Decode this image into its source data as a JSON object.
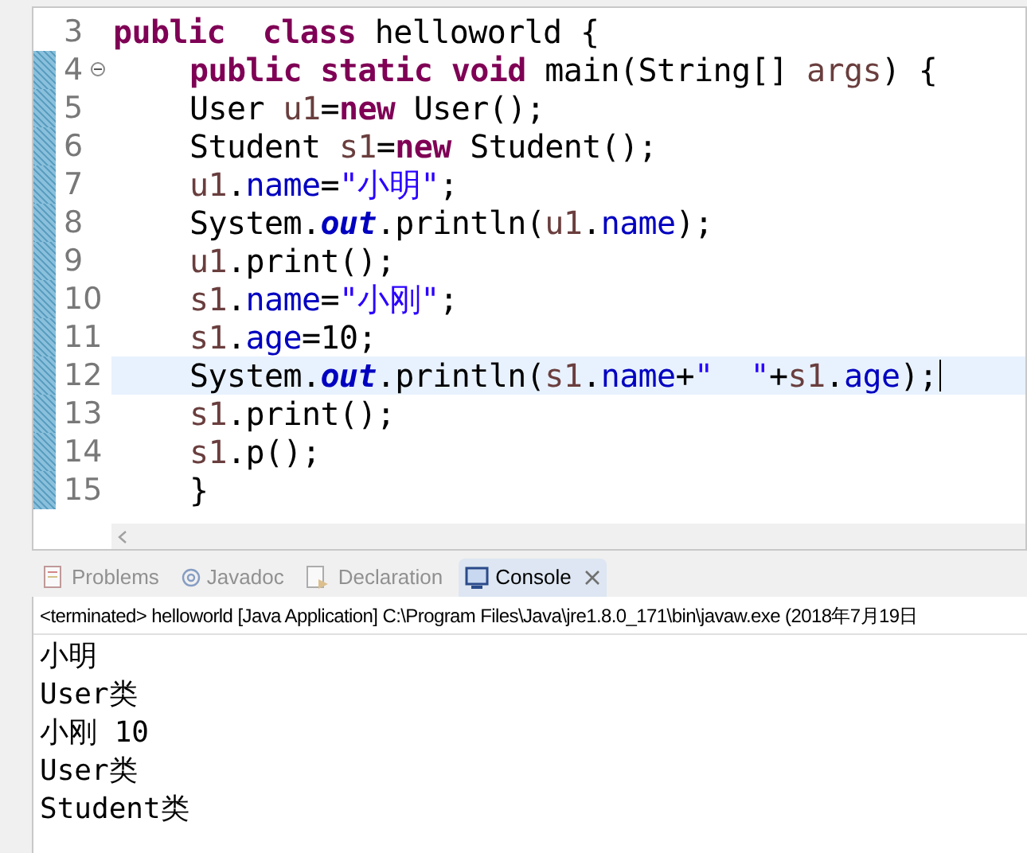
{
  "editor": {
    "lines": [
      {
        "number": "3",
        "fold": false,
        "changed": false,
        "current": false,
        "indented": false,
        "tokens": [
          {
            "kind": "kw",
            "text": "public  class"
          },
          {
            "kind": "plain",
            "text": " helloworld {"
          }
        ]
      },
      {
        "number": "4",
        "fold": true,
        "changed": true,
        "current": false,
        "indented": true,
        "tokens": [
          {
            "kind": "kw",
            "text": "public static void"
          },
          {
            "kind": "plain",
            "text": " main(String[] "
          },
          {
            "kind": "local",
            "text": "args"
          },
          {
            "kind": "plain",
            "text": ") {"
          }
        ]
      },
      {
        "number": "5",
        "fold": false,
        "changed": true,
        "current": false,
        "indented": true,
        "tokens": [
          {
            "kind": "plain",
            "text": "User "
          },
          {
            "kind": "local",
            "text": "u1"
          },
          {
            "kind": "plain",
            "text": "="
          },
          {
            "kind": "kw",
            "text": "new"
          },
          {
            "kind": "plain",
            "text": " User();"
          }
        ]
      },
      {
        "number": "6",
        "fold": false,
        "changed": true,
        "current": false,
        "indented": true,
        "tokens": [
          {
            "kind": "plain",
            "text": "Student "
          },
          {
            "kind": "local",
            "text": "s1"
          },
          {
            "kind": "plain",
            "text": "="
          },
          {
            "kind": "kw",
            "text": "new"
          },
          {
            "kind": "plain",
            "text": " Student();"
          }
        ]
      },
      {
        "number": "7",
        "fold": false,
        "changed": true,
        "current": false,
        "indented": true,
        "tokens": [
          {
            "kind": "local",
            "text": "u1"
          },
          {
            "kind": "plain",
            "text": "."
          },
          {
            "kind": "field",
            "text": "name"
          },
          {
            "kind": "plain",
            "text": "="
          },
          {
            "kind": "str",
            "text": "\"小明\""
          },
          {
            "kind": "plain",
            "text": ";"
          }
        ]
      },
      {
        "number": "8",
        "fold": false,
        "changed": true,
        "current": false,
        "indented": true,
        "tokens": [
          {
            "kind": "plain",
            "text": "System."
          },
          {
            "kind": "static",
            "text": "out"
          },
          {
            "kind": "plain",
            "text": ".println("
          },
          {
            "kind": "local",
            "text": "u1"
          },
          {
            "kind": "plain",
            "text": "."
          },
          {
            "kind": "field",
            "text": "name"
          },
          {
            "kind": "plain",
            "text": ");"
          }
        ]
      },
      {
        "number": "9",
        "fold": false,
        "changed": true,
        "current": false,
        "indented": true,
        "tokens": [
          {
            "kind": "local",
            "text": "u1"
          },
          {
            "kind": "plain",
            "text": ".print();"
          }
        ]
      },
      {
        "number": "10",
        "fold": false,
        "changed": true,
        "current": false,
        "indented": true,
        "tokens": [
          {
            "kind": "local",
            "text": "s1"
          },
          {
            "kind": "plain",
            "text": "."
          },
          {
            "kind": "field",
            "text": "name"
          },
          {
            "kind": "plain",
            "text": "="
          },
          {
            "kind": "str",
            "text": "\"小刚\""
          },
          {
            "kind": "plain",
            "text": ";"
          }
        ]
      },
      {
        "number": "11",
        "fold": false,
        "changed": true,
        "current": false,
        "indented": true,
        "tokens": [
          {
            "kind": "local",
            "text": "s1"
          },
          {
            "kind": "plain",
            "text": "."
          },
          {
            "kind": "field",
            "text": "age"
          },
          {
            "kind": "plain",
            "text": "=10;"
          }
        ]
      },
      {
        "number": "12",
        "fold": false,
        "changed": true,
        "current": true,
        "indented": true,
        "tokens": [
          {
            "kind": "plain",
            "text": "System."
          },
          {
            "kind": "static",
            "text": "out"
          },
          {
            "kind": "plain",
            "text": ".println("
          },
          {
            "kind": "local",
            "text": "s1"
          },
          {
            "kind": "plain",
            "text": "."
          },
          {
            "kind": "field",
            "text": "name"
          },
          {
            "kind": "plain",
            "text": "+"
          },
          {
            "kind": "str",
            "text": "\"  \""
          },
          {
            "kind": "plain",
            "text": "+"
          },
          {
            "kind": "local",
            "text": "s1"
          },
          {
            "kind": "plain",
            "text": "."
          },
          {
            "kind": "field",
            "text": "age"
          },
          {
            "kind": "plain",
            "text": ");"
          }
        ]
      },
      {
        "number": "13",
        "fold": false,
        "changed": true,
        "current": false,
        "indented": true,
        "tokens": [
          {
            "kind": "local",
            "text": "s1"
          },
          {
            "kind": "plain",
            "text": ".print();"
          }
        ]
      },
      {
        "number": "14",
        "fold": false,
        "changed": true,
        "current": false,
        "indented": true,
        "tokens": [
          {
            "kind": "local",
            "text": "s1"
          },
          {
            "kind": "plain",
            "text": ".p();"
          }
        ]
      },
      {
        "number": "15",
        "fold": false,
        "changed": true,
        "current": false,
        "indented": true,
        "tokens": [
          {
            "kind": "plain",
            "text": "}"
          }
        ]
      }
    ]
  },
  "panel": {
    "tabs": [
      {
        "kind": "problems",
        "label": "Problems",
        "selected": false,
        "closable": false
      },
      {
        "kind": "javadoc",
        "label": "Javadoc",
        "selected": false,
        "closable": false
      },
      {
        "kind": "declaration",
        "label": "Declaration",
        "selected": false,
        "closable": false
      },
      {
        "kind": "console",
        "label": "Console",
        "selected": true,
        "closable": true
      }
    ],
    "status": "<terminated> helloworld [Java Application] C:\\Program Files\\Java\\jre1.8.0_171\\bin\\javaw.exe (2018年7月19日",
    "output": [
      "小明",
      "User类",
      "小刚 10",
      "User类",
      "Student类"
    ]
  }
}
